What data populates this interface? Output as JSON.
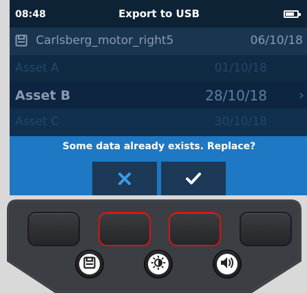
{
  "statusbar": {
    "time": "08:48",
    "title": "Export to USB",
    "battery_level": 0.85
  },
  "file": {
    "name": "Carlsberg_motor_right5",
    "date": "06/10/18",
    "icon": "save-icon"
  },
  "assets": [
    {
      "name": "Asset A",
      "date": "01/10/18"
    },
    {
      "name": "Asset B",
      "date": "28/10/18",
      "chevron": "›"
    },
    {
      "name": "Asset C",
      "date": "30/10/18"
    }
  ],
  "dialog": {
    "message": "Some data already exists. Replace?",
    "cancel_icon": "close-icon",
    "confirm_icon": "check-icon"
  },
  "hardware": {
    "soft_keys": 4,
    "soft_key_highlight_color": "#dd1111",
    "round_buttons": [
      "save-icon",
      "brightness-icon",
      "volume-icon"
    ]
  }
}
